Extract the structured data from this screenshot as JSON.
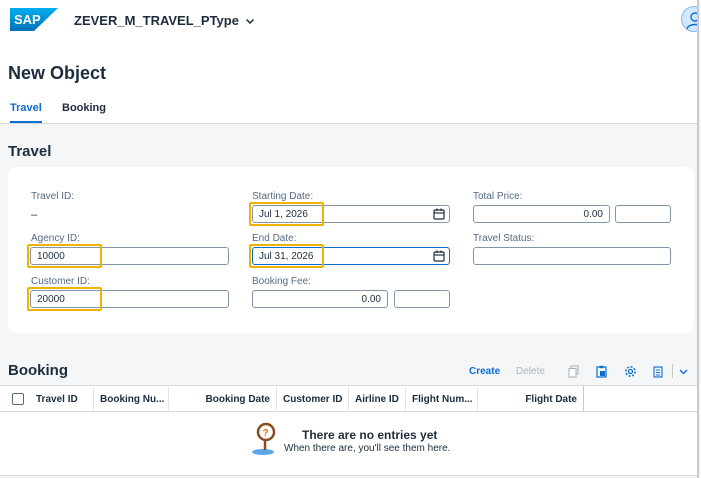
{
  "shell": {
    "logo_text": "SAP",
    "app_title": "ZEVER_M_TRAVEL_PType"
  },
  "header": {
    "page_title": "New Object",
    "tabs": [
      {
        "label": "Travel",
        "selected": true
      },
      {
        "label": "Booking",
        "selected": false
      }
    ]
  },
  "travel": {
    "section_title": "Travel",
    "fields": {
      "travel_id": {
        "label": "Travel ID:",
        "value": "–"
      },
      "agency_id": {
        "label": "Agency ID:",
        "value": "10000"
      },
      "customer_id": {
        "label": "Customer ID:",
        "value": "20000"
      },
      "starting_date": {
        "label": "Starting Date:",
        "value": "Jul 1, 2026"
      },
      "end_date": {
        "label": "End Date:",
        "value": "Jul 31, 2026"
      },
      "booking_fee": {
        "label": "Booking Fee:",
        "value": "0.00",
        "currency": ""
      },
      "total_price": {
        "label": "Total Price:",
        "value": "0.00",
        "currency": ""
      },
      "travel_status": {
        "label": "Travel Status:",
        "value": ""
      }
    }
  },
  "booking": {
    "section_title": "Booking",
    "toolbar": {
      "create_label": "Create",
      "delete_label": "Delete"
    },
    "columns": [
      "Travel ID",
      "Booking Nu...",
      "Booking Date",
      "Customer ID",
      "Airline ID",
      "Flight Num...",
      "Flight Date"
    ],
    "empty_title": "There are no entries yet",
    "empty_subtitle": "When there are, you'll see them here."
  },
  "colors": {
    "brand_blue": "#0a6ed1",
    "highlight": "#f0b400",
    "text": "#1d2d3e",
    "label": "#556b82"
  }
}
